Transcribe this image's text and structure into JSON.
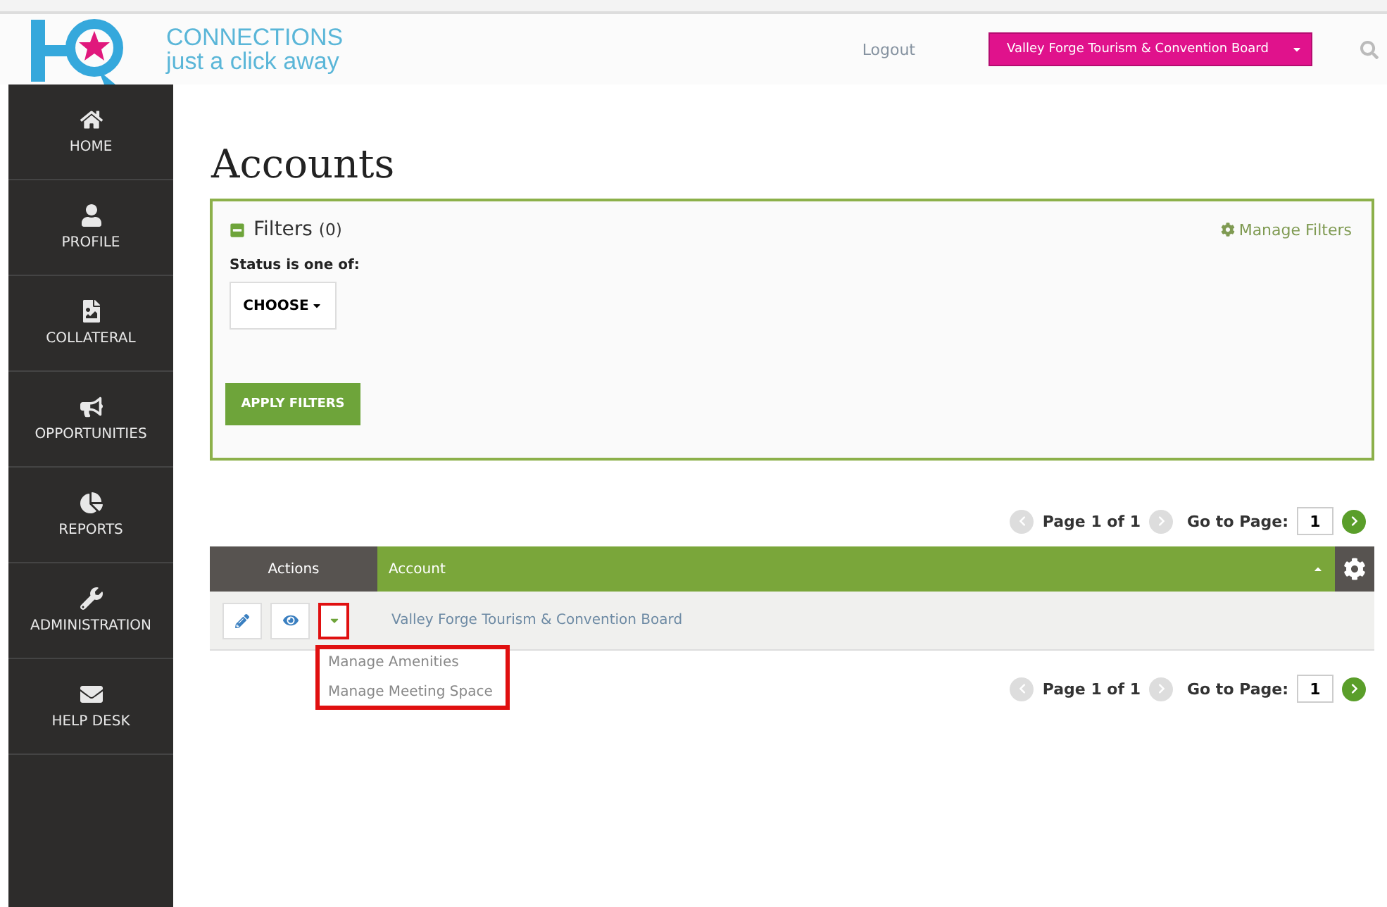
{
  "header": {
    "brand": "CONNECTIONS",
    "tagline": "just a click away",
    "logout": "Logout",
    "account_select": "Valley Forge Tourism & Convention Board"
  },
  "sidebar": {
    "items": [
      {
        "label": "HOME"
      },
      {
        "label": "PROFILE"
      },
      {
        "label": "COLLATERAL"
      },
      {
        "label": "OPPORTUNITIES"
      },
      {
        "label": "REPORTS"
      },
      {
        "label": "ADMINISTRATION"
      },
      {
        "label": "HELP DESK"
      }
    ]
  },
  "page_title": "Accounts",
  "filters": {
    "title": "Filters",
    "count": "(0)",
    "expanded": true,
    "manage": "Manage Filters",
    "status_label": "Status is one of:",
    "choose": "CHOOSE",
    "apply": "APPLY FILTERS"
  },
  "pagination_top": {
    "page": "Page 1 of 1",
    "goto": "Go to Page:",
    "value": "1"
  },
  "table": {
    "columns": [
      "Actions",
      "Account"
    ],
    "rows": [
      {
        "account": "Valley Forge Tourism & Convention Board",
        "menu_highlighted": true,
        "menu": [
          "Manage Amenities",
          "Manage Meeting Space"
        ]
      }
    ]
  },
  "pagination_bottom": {
    "page": "Page 1 of 1",
    "goto": "Go to Page:",
    "value": "1"
  }
}
